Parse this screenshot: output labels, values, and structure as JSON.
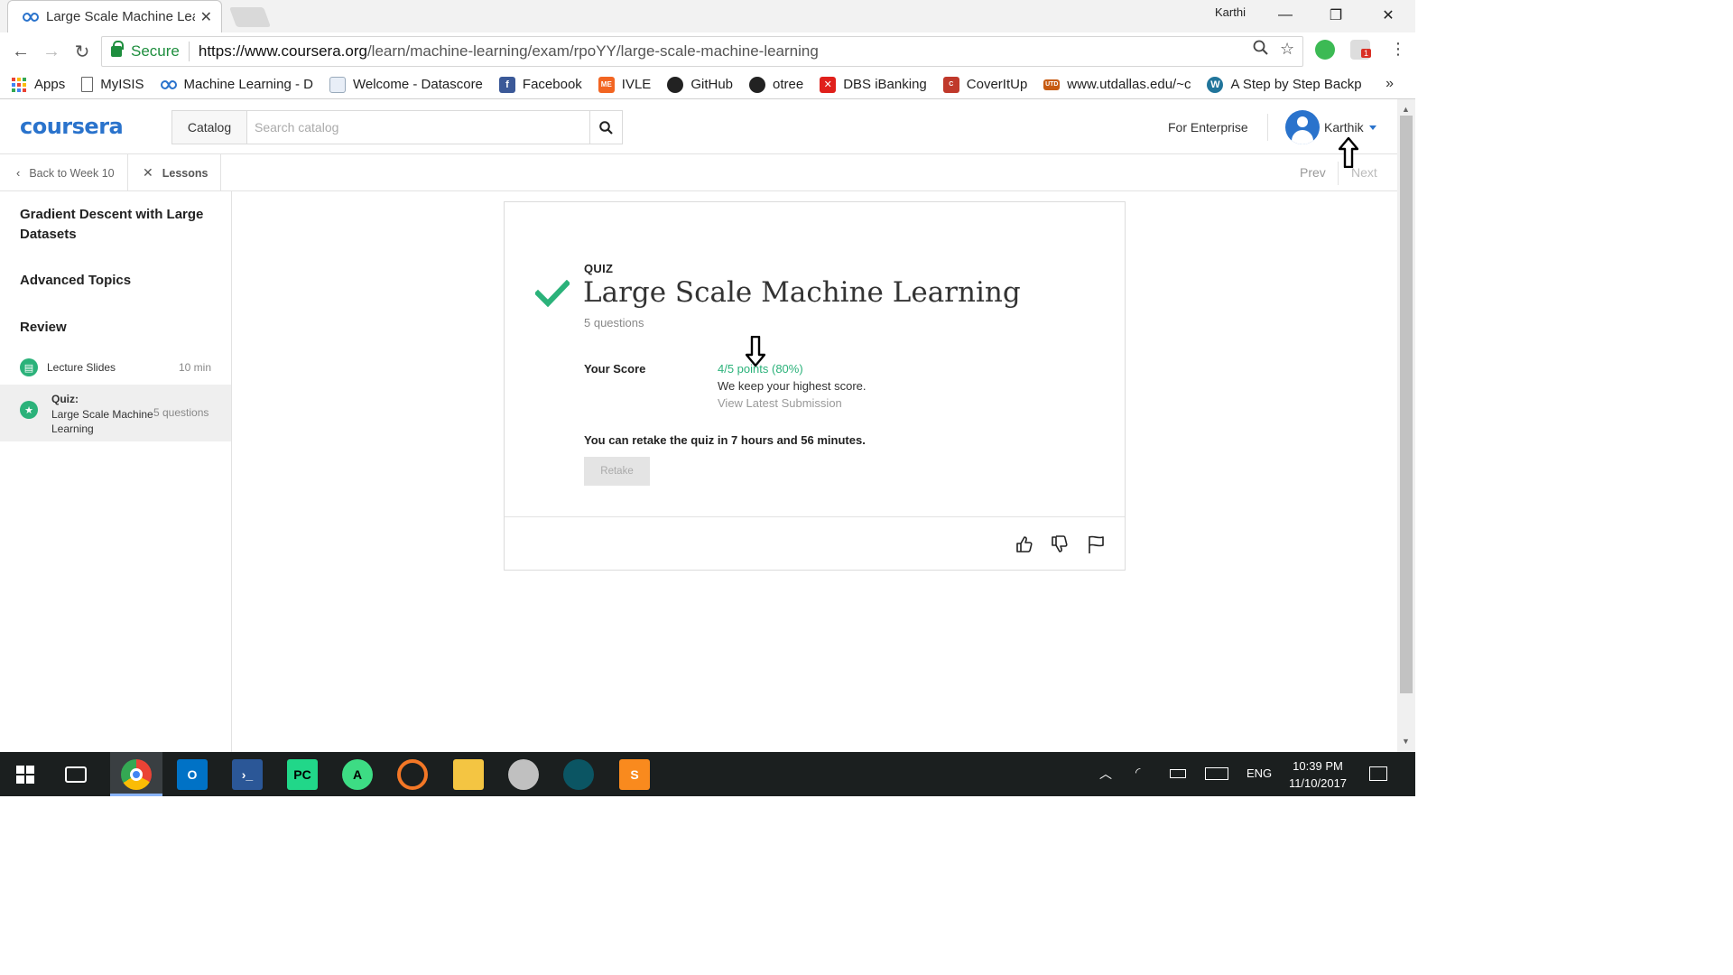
{
  "browser": {
    "tab_title": "Large Scale Machine Lear",
    "window_user": "Karthi",
    "secure_label": "Secure",
    "url_prefix": "https://www.coursera.org",
    "url_path": "/learn/machine-learning/exam/rpoYY/large-scale-machine-learning",
    "extension_badge": "1",
    "bookmarks": [
      {
        "label": "Apps",
        "icon": "apps-grid-icon"
      },
      {
        "label": "MyISIS",
        "icon": "page-icon"
      },
      {
        "label": "Machine Learning - D",
        "icon": "coursera-icon"
      },
      {
        "label": "Welcome - Datascore",
        "icon": "document-icon"
      },
      {
        "label": "Facebook",
        "icon": "facebook-icon"
      },
      {
        "label": "IVLE",
        "icon": "ivle-icon"
      },
      {
        "label": "GitHub",
        "icon": "github-icon"
      },
      {
        "label": "otree",
        "icon": "github-icon"
      },
      {
        "label": "DBS iBanking",
        "icon": "dbs-icon"
      },
      {
        "label": "CoverItUp",
        "icon": "coveritup-icon"
      },
      {
        "label": "www.utdallas.edu/~c",
        "icon": "utd-icon"
      },
      {
        "label": "A Step by Step Backp",
        "icon": "wordpress-icon"
      }
    ],
    "bookmarks_more": "»"
  },
  "header": {
    "logo": "coursera",
    "catalog_label": "Catalog",
    "search_placeholder": "Search catalog",
    "enterprise_label": "For Enterprise",
    "username": "Karthik"
  },
  "subnav": {
    "back_label": "Back to Week 10",
    "lessons_label": "Lessons",
    "prev_label": "Prev",
    "next_label": "Next"
  },
  "sidebar": {
    "sections": [
      "Gradient Descent with Large Datasets",
      "Advanced Topics",
      "Review"
    ],
    "items": [
      {
        "title": "Lecture Slides",
        "meta": "10 min",
        "icon": "reading-icon"
      },
      {
        "kind": "Quiz:",
        "title": "Large Scale Machine Learning",
        "meta": "5 questions",
        "icon": "quiz-star-icon"
      }
    ]
  },
  "quiz": {
    "label": "QUIZ",
    "title": "Large Scale Machine Learning",
    "question_count": "5 questions",
    "score_label": "Your Score",
    "score_value": "4/5 points (80%)",
    "score_note": "We keep your highest score.",
    "view_latest": "View Latest Submission",
    "retake_note": "You can retake the quiz in 7 hours and 56 minutes.",
    "retake_label": "Retake"
  },
  "colors": {
    "brand": "#2a73cc",
    "success": "#2bb27a",
    "secure": "#1e8e3e"
  },
  "taskbar": {
    "language": "ENG",
    "time": "10:39 PM",
    "date": "11/10/2017"
  }
}
